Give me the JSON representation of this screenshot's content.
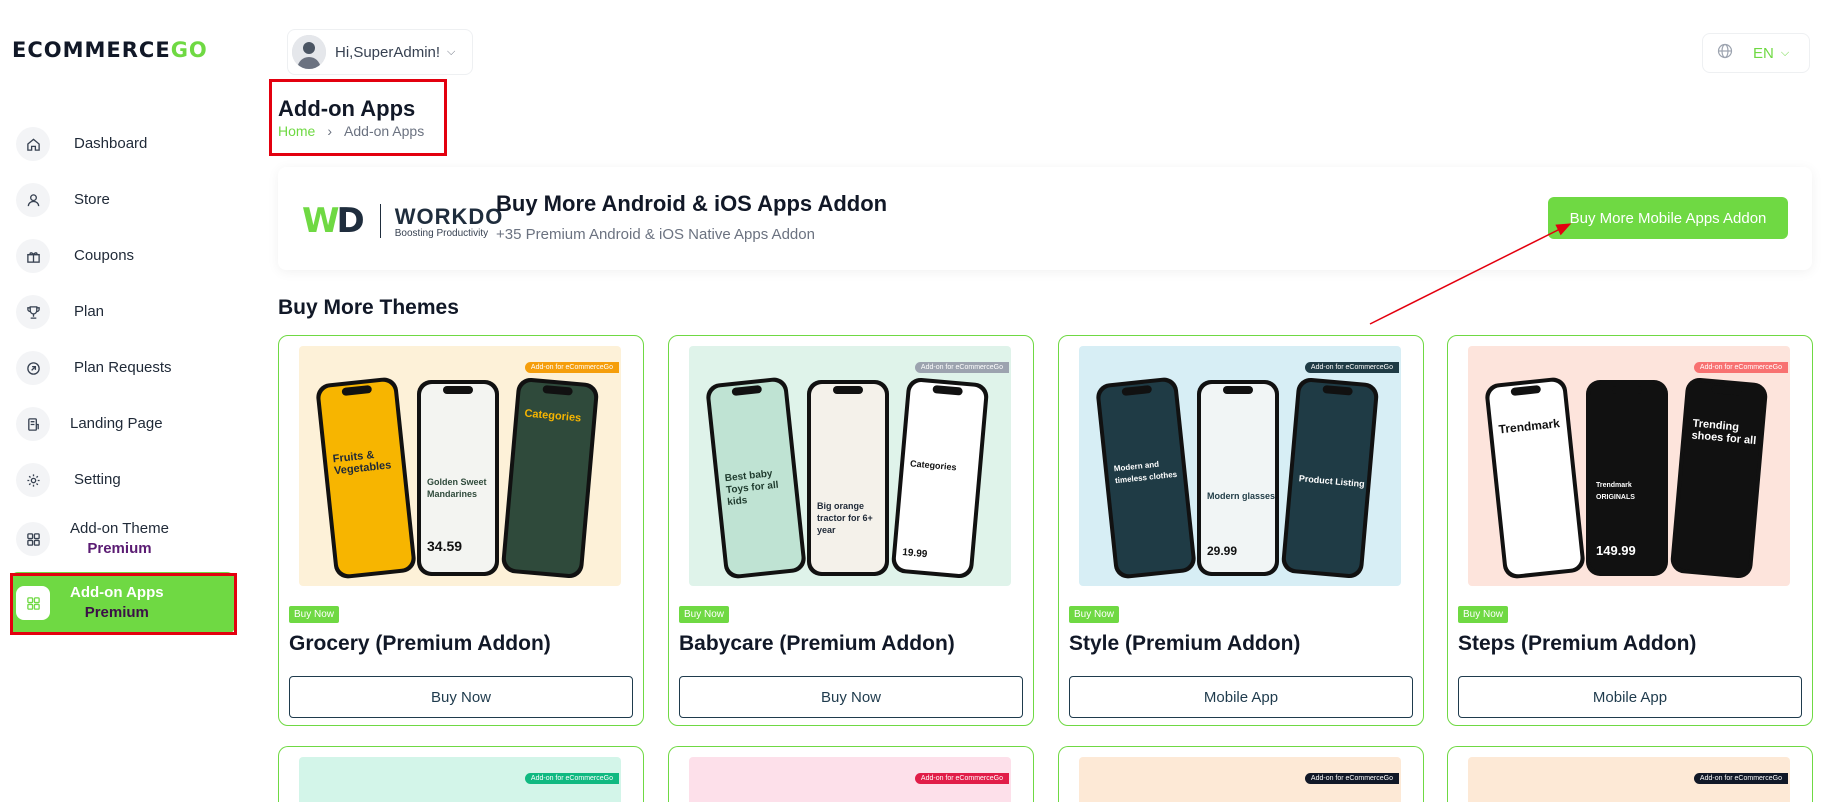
{
  "app": {
    "logo_text": "ECOMMERCE",
    "logo_accent": "GO",
    "accent_color": "#6fd943",
    "highlight_color": "#e3000f"
  },
  "sidebar": {
    "items": [
      {
        "label": "Dashboard",
        "icon": "home-icon"
      },
      {
        "label": "Store",
        "icon": "user-icon"
      },
      {
        "label": "Coupons",
        "icon": "gift-icon"
      },
      {
        "label": "Plan",
        "icon": "trophy-icon"
      },
      {
        "label": "Plan Requests",
        "icon": "request-icon"
      },
      {
        "label": "Landing Page",
        "icon": "landing-page-icon"
      },
      {
        "label": "Setting",
        "icon": "gear-icon"
      },
      {
        "label": "Add-on Theme",
        "sub": "Premium",
        "icon": "grid-icon"
      },
      {
        "label": "Add-on Apps",
        "sub": "Premium",
        "icon": "grid-icon",
        "active": true
      }
    ]
  },
  "header": {
    "user_greeting": "Hi,SuperAdmin!",
    "language": "EN"
  },
  "page": {
    "title": "Add-on Apps",
    "breadcrumb": {
      "home": "Home",
      "current": "Add-on Apps"
    }
  },
  "banner": {
    "brand_name": "WORKDO",
    "brand_tagline": "Boosting Productivity",
    "title": "Buy More Android & iOS Apps Addon",
    "subtitle": "+35 Premium Android & iOS Native Apps Addon",
    "button_label": "Buy More Mobile Apps Addon"
  },
  "themes": {
    "section_title": "Buy More Themes",
    "tag_text": "Add-on for eCommerceGo",
    "badge_label": "Buy Now",
    "cards": [
      {
        "title": "Grocery (Premium Addon)",
        "button": "Buy Now",
        "bg": "#fdf1d8",
        "tag_color": "#f59e0b",
        "screen_colors": [
          "#f7b500",
          "#f3f4f1",
          "#2f4a3b"
        ],
        "screen_texts": [
          "Fruits & Vegetables",
          "Golden Sweet Mandarines",
          "Categories"
        ],
        "price": "34.59"
      },
      {
        "title": "Babycare (Premium Addon)",
        "button": "Buy Now",
        "bg": "#dff3ea",
        "tag_color": "#9ca3af",
        "screen_colors": [
          "#bfe3d3",
          "#f4f1ea",
          "#ffffff"
        ],
        "screen_texts": [
          "Best baby Toys for all kids",
          "Big orange tractor for 6+ year",
          "Categories"
        ],
        "price": "19.99"
      },
      {
        "title": "Style (Premium Addon)",
        "button": "Mobile App",
        "bg": "#d7eef5",
        "tag_color": "#1f3b45",
        "screen_colors": [
          "#1f3b45",
          "#f1f5f5",
          "#1f3b45"
        ],
        "screen_texts": [
          "Modern and timeless clothes",
          "Modern glasses",
          "Product Listing"
        ],
        "price": "29.99"
      },
      {
        "title": "Steps (Premium Addon)",
        "button": "Mobile App",
        "bg": "#fde4dc",
        "tag_color": "#f87171",
        "screen_colors": [
          "#ffffff",
          "#111111",
          "#111111"
        ],
        "screen_texts": [
          "Trendmark",
          "Trendmark ORIGINALS",
          "Trending shoes for all"
        ],
        "price": "149.99"
      },
      {
        "bg": "#d3f5e9",
        "tag_color": "#10b981"
      },
      {
        "bg": "#fde0ea",
        "tag_color": "#e11d48"
      },
      {
        "bg": "#fde9d6",
        "tag_color": "#111827"
      },
      {
        "bg": "#fde9d6",
        "tag_color": "#111827"
      }
    ]
  }
}
